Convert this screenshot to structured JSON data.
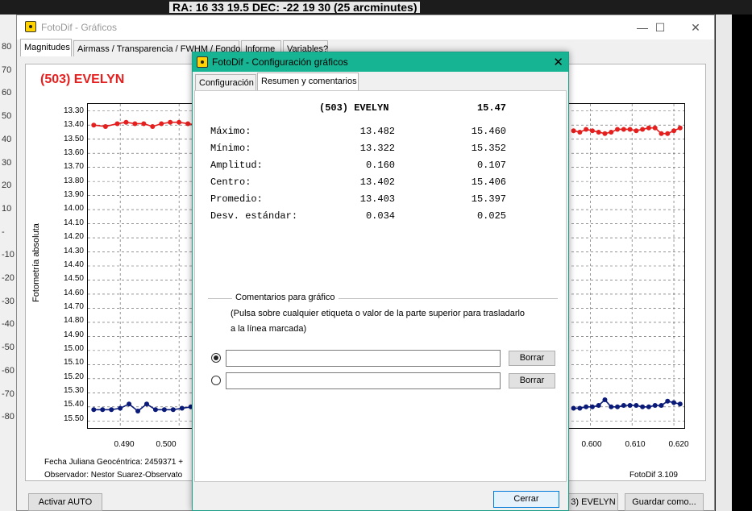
{
  "background": {
    "coords_text": "RA: 16 33 19.5  DEC: -22 19 30 (25 arcminutes)",
    "left_axis_labels": [
      "80",
      "70",
      "60",
      "50",
      "40",
      "30",
      "20",
      "10",
      "-",
      "-10",
      "-20",
      "-30",
      "-40",
      "-50",
      "-60",
      "-70",
      "-80"
    ]
  },
  "main_window": {
    "title": "FotoDif - Gráficos",
    "minimize_glyph": "—",
    "maximize_glyph": "☐",
    "close_glyph": "✕",
    "tabs": [
      "Magnitudes",
      "Airmass / Transparencia / FWHM / Fondo",
      "Informe",
      "Variables?"
    ],
    "active_tab": "Magnitudes",
    "object_title": "(503) EVELYN",
    "y_axis_label": "Fotometría absoluta",
    "y_ticks": [
      "13.30",
      "13.40",
      "13.50",
      "13.60",
      "13.70",
      "13.80",
      "13.90",
      "14.00",
      "14.10",
      "14.20",
      "14.30",
      "14.40",
      "14.50",
      "14.60",
      "14.70",
      "14.80",
      "14.90",
      "15.00",
      "15.10",
      "15.20",
      "15.30",
      "15.40",
      "15.50"
    ],
    "x_ticks": [
      "0.490",
      "0.500",
      "0.600",
      "0.610",
      "0.620"
    ],
    "footer_line1": "Fecha Juliana Geocéntrica: 2459371 +",
    "footer_line2": "Observador: Nestor Suarez-Observato",
    "version": "FotoDif 3.109",
    "buttons": {
      "activar_auto": "Activar AUTO",
      "evelyn": "3) EVELYN",
      "guardar": "Guardar como..."
    },
    "colors": {
      "red_series": "#e51e1e",
      "blue_series": "#0a1a78"
    }
  },
  "chart_data": {
    "type": "line",
    "title": "(503) EVELYN",
    "xlabel": "",
    "ylabel": "Fotometría absoluta",
    "ylim": [
      15.55,
      13.25
    ],
    "y_inverted": true,
    "grid": true,
    "x_segments_visible": [
      [
        0.4845,
        0.5045
      ],
      [
        0.5955,
        0.6225
      ]
    ],
    "series": [
      {
        "color": "#e51e1e",
        "x": [
          0.4855,
          0.4875,
          0.4895,
          0.491,
          0.4925,
          0.494,
          0.4955,
          0.497,
          0.4985,
          0.5,
          0.5015,
          0.503,
          0.596,
          0.5975,
          0.599,
          0.6005,
          0.602,
          0.6035,
          0.605,
          0.6065,
          0.608,
          0.6095,
          0.611,
          0.6125,
          0.614,
          0.6155,
          0.617,
          0.6185,
          0.62,
          0.6215
        ],
        "y": [
          13.4,
          13.41,
          13.39,
          13.38,
          13.39,
          13.39,
          13.41,
          13.39,
          13.38,
          13.38,
          13.39,
          13.4,
          13.44,
          13.45,
          13.43,
          13.44,
          13.45,
          13.46,
          13.45,
          13.43,
          13.43,
          13.43,
          13.44,
          13.43,
          13.42,
          13.42,
          13.46,
          13.46,
          13.44,
          13.42
        ]
      },
      {
        "color": "#0a1a78",
        "x": [
          0.4855,
          0.487,
          0.4885,
          0.49,
          0.4915,
          0.493,
          0.4945,
          0.496,
          0.4975,
          0.499,
          0.5005,
          0.502,
          0.5035,
          0.596,
          0.5975,
          0.599,
          0.6005,
          0.602,
          0.6035,
          0.605,
          0.6065,
          0.608,
          0.6095,
          0.611,
          0.6125,
          0.614,
          0.6155,
          0.617,
          0.6185,
          0.62,
          0.6215
        ],
        "y": [
          15.42,
          15.42,
          15.42,
          15.41,
          15.38,
          15.43,
          15.38,
          15.42,
          15.42,
          15.42,
          15.41,
          15.4,
          15.42,
          15.41,
          15.41,
          15.4,
          15.4,
          15.39,
          15.35,
          15.4,
          15.4,
          15.39,
          15.39,
          15.39,
          15.4,
          15.4,
          15.39,
          15.39,
          15.36,
          15.37,
          15.38
        ]
      }
    ]
  },
  "dialog": {
    "title": "FotoDif - Configuración gráficos",
    "close_glyph": "✕",
    "tabs": [
      "Configuración",
      "Resumen y comentarios"
    ],
    "active_tab": "Resumen y comentarios",
    "header": {
      "object": "(503) EVELYN",
      "comp": "15.47"
    },
    "stats": [
      {
        "label": "Máximo:",
        "v1": "13.482",
        "v2": "15.460"
      },
      {
        "label": "Mínimo:",
        "v1": "13.322",
        "v2": "15.352"
      },
      {
        "label": "Amplitud:",
        "v1": "0.160",
        "v2": "0.107"
      },
      {
        "label": "Centro:",
        "v1": "13.402",
        "v2": "15.406"
      },
      {
        "label": "Promedio:",
        "v1": "13.403",
        "v2": "15.397"
      },
      {
        "label": "Desv. estándar:",
        "v1": "0.034",
        "v2": "0.025"
      }
    ],
    "comments_group": "Comentarios para gráfico",
    "hint_line1": "(Pulsa sobre cualquier etiqueta o valor de la parte superior para trasladarlo",
    "hint_line2": "a la línea marcada)",
    "comment1": "",
    "comment2": "",
    "borrar": "Borrar",
    "cerrar": "Cerrar"
  }
}
